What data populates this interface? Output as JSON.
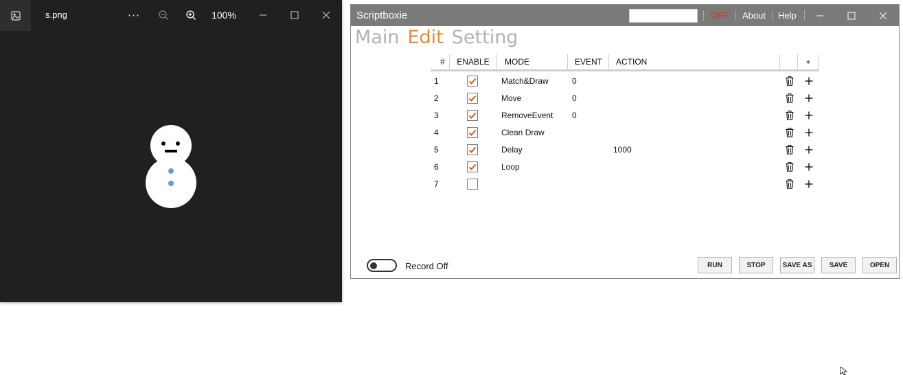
{
  "viewer": {
    "filename": "s.png",
    "zoom": "100%",
    "more_label": "···"
  },
  "scriptboxie": {
    "title": "Scriptboxie",
    "search_value": "",
    "status": "OFF",
    "about": "About",
    "help": "Help",
    "tabs": [
      {
        "label": "Main"
      },
      {
        "label": "Edit"
      },
      {
        "label": "Setting"
      }
    ],
    "table": {
      "headers": [
        "#",
        "ENABLE",
        "MODE",
        "EVENT",
        "ACTION",
        "",
        "+"
      ],
      "rows": [
        {
          "num": "1",
          "enabled": true,
          "mode": "Match&Draw",
          "event": "0",
          "action": ""
        },
        {
          "num": "2",
          "enabled": true,
          "mode": "Move",
          "event": "0",
          "action": ""
        },
        {
          "num": "3",
          "enabled": true,
          "mode": "RemoveEvent",
          "event": "0",
          "action": ""
        },
        {
          "num": "4",
          "enabled": true,
          "mode": "Clean Draw",
          "event": "",
          "action": ""
        },
        {
          "num": "5",
          "enabled": true,
          "mode": "Delay",
          "event": "",
          "action": "1000"
        },
        {
          "num": "6",
          "enabled": true,
          "mode": "Loop",
          "event": "",
          "action": ""
        },
        {
          "num": "7",
          "enabled": false,
          "mode": "",
          "event": "",
          "action": ""
        }
      ]
    },
    "record_label": "Record Off",
    "buttons": {
      "run": "RUN",
      "stop": "STOP",
      "save_as": "SAVE AS",
      "save": "SAVE",
      "open": "OPEN"
    },
    "colors": {
      "accent": "#e68a3c",
      "check": "#c8621a",
      "off": "#c0392b",
      "titlebar": "#7a7a7a"
    }
  }
}
